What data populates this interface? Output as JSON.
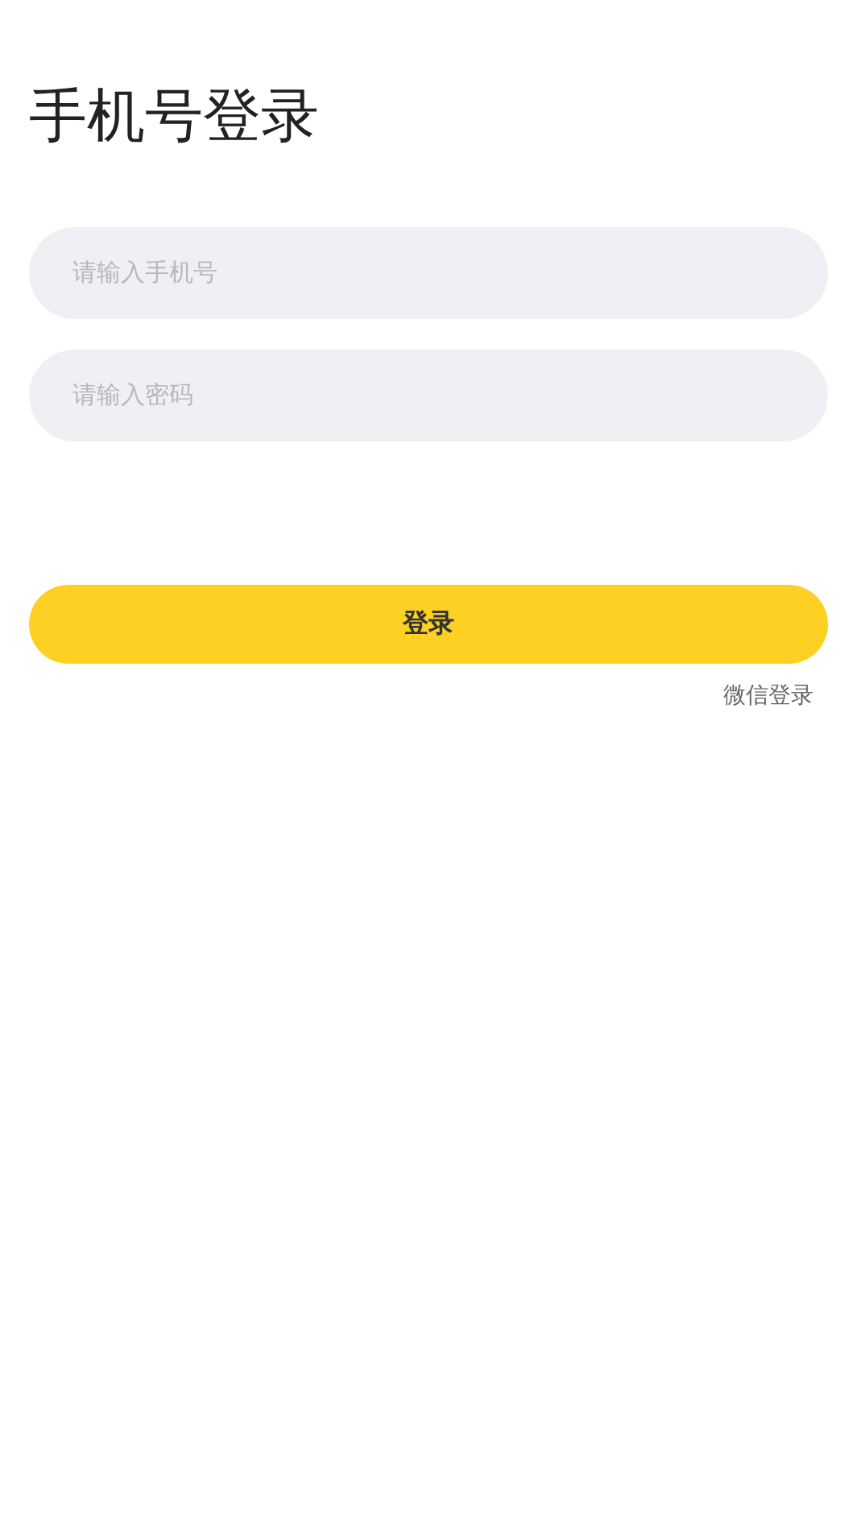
{
  "title": "手机号登录",
  "fields": [
    {
      "placeholder": "请输入手机号"
    },
    {
      "placeholder": "请输入密码"
    }
  ],
  "login_button": "登录",
  "wechat_link": "微信登录"
}
